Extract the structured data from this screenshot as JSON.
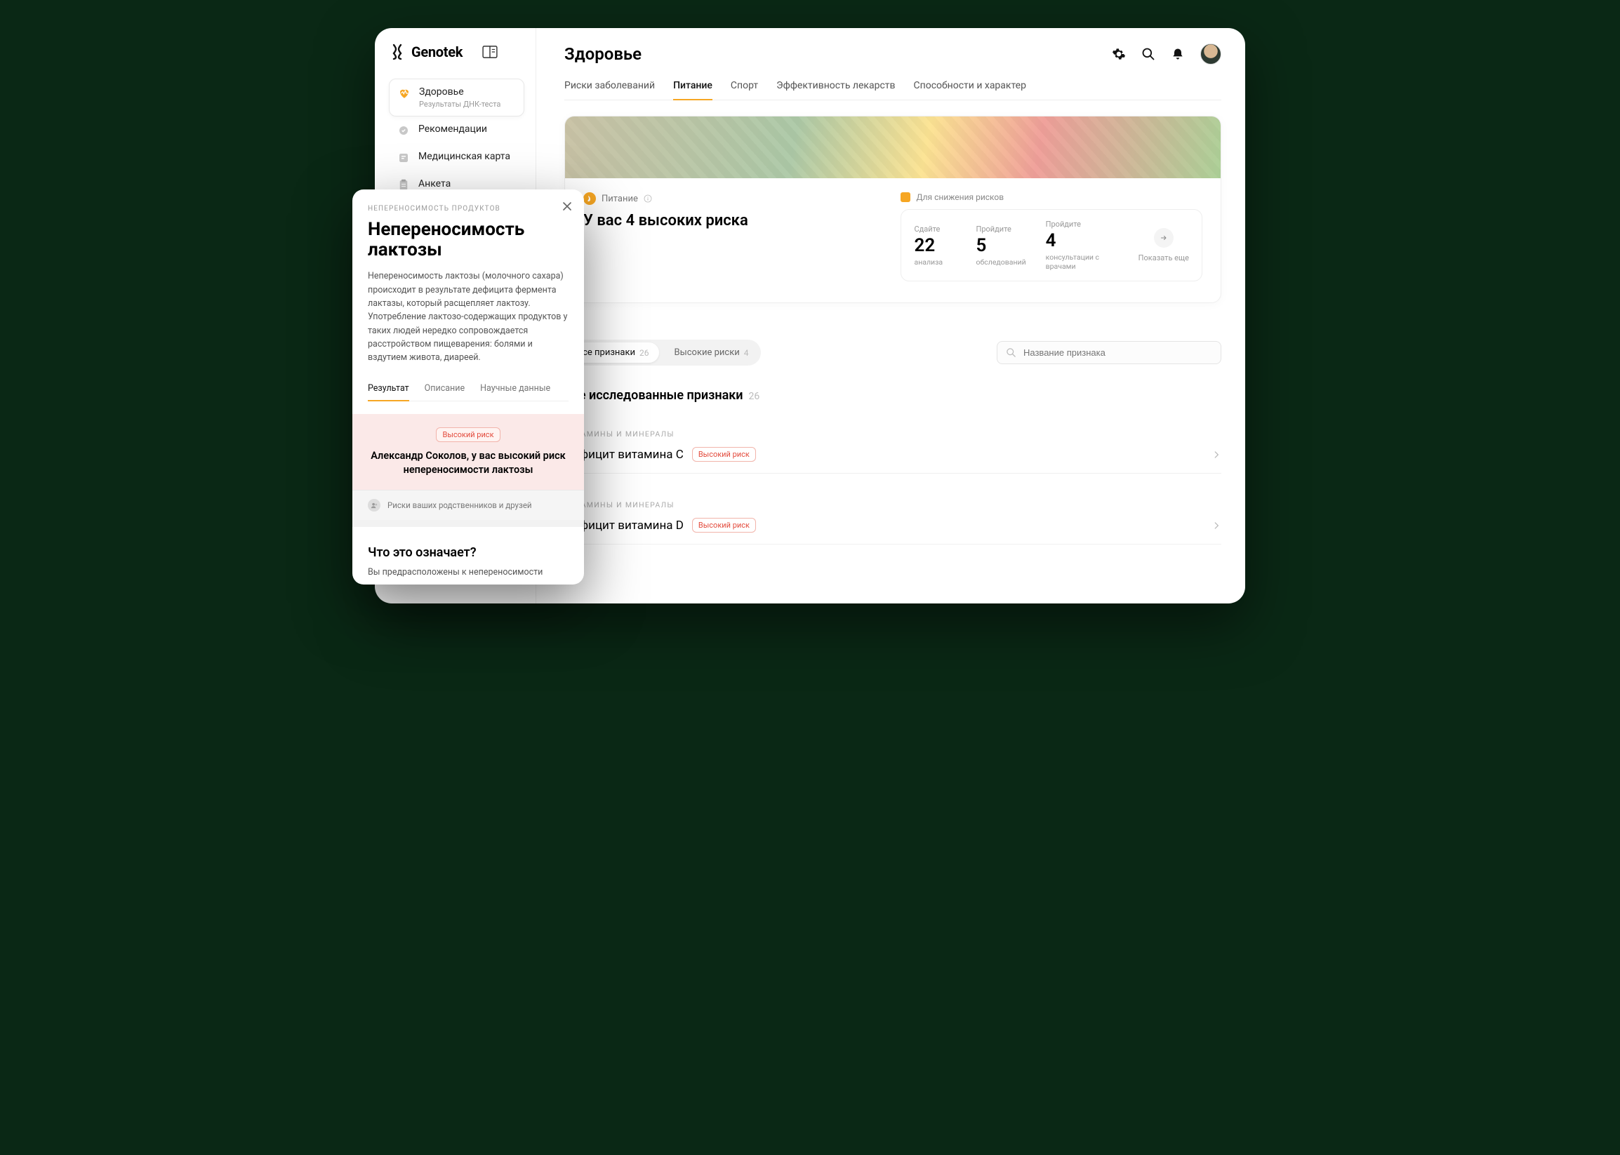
{
  "brand": {
    "name": "Genotek"
  },
  "sidebar": {
    "items": [
      {
        "label": "Здоровье",
        "sub": "Результаты ДНК-теста",
        "icon": "heart-icon",
        "active": true
      },
      {
        "label": "Рекомендации",
        "icon": "badge-icon"
      },
      {
        "label": "Медицинская карта",
        "icon": "card-icon"
      },
      {
        "label": "Анкета",
        "icon": "form-icon"
      }
    ]
  },
  "header": {
    "title": "Здоровье"
  },
  "tabs": [
    {
      "label": "Риски заболеваний"
    },
    {
      "label": "Питание",
      "active": true
    },
    {
      "label": "Спорт"
    },
    {
      "label": "Эффективность лекарств"
    },
    {
      "label": "Способности и характер"
    }
  ],
  "hero": {
    "label": "Питание",
    "headline": "У вас 4 высоких риска",
    "reduce_label": "Для снижения рисков",
    "stats": [
      {
        "cap": "Сдайте",
        "num": "22",
        "sub": "анализа"
      },
      {
        "cap": "Пройдите",
        "num": "5",
        "sub": "обследований"
      },
      {
        "cap": "Пройдите",
        "num": "4",
        "sub": "консультации с врачами"
      }
    ],
    "show_more": "Показать еще"
  },
  "filters": {
    "chips": [
      {
        "label": "Все признаки",
        "count": "26",
        "active": true
      },
      {
        "label": "Высокие риски",
        "count": "4"
      }
    ],
    "search_placeholder": "Название признака"
  },
  "section": {
    "title": "Все исследованные признаки",
    "count": "26"
  },
  "groups": [
    {
      "label": "ВИТАМИНЫ И МИНЕРАЛЫ",
      "name": "Дефицит витамина C",
      "risk": "Высокий риск"
    },
    {
      "label": "ВИТАМИНЫ И МИНЕРАЛЫ",
      "name": "Дефицит витамина D",
      "risk": "Высокий риск"
    }
  ],
  "modal": {
    "eyebrow": "НЕПЕРЕНОСИМОСТЬ ПРОДУКТОВ",
    "title": "Непереносимость лактозы",
    "desc": "Непереносимость лактозы (молочного сахара) происходит в результате дефицита фермента лактазы, который расщепляет лактозу. Употребление лактозо-содержащих продуктов у таких людей нередко сопровождается расстройством пищеварения: болями и вздутием живота, диареей.",
    "tabs": [
      {
        "label": "Результат",
        "active": true
      },
      {
        "label": "Описание"
      },
      {
        "label": "Научные данные"
      }
    ],
    "risk_badge": "Высокий риск",
    "risk_msg": "Александр Соколов, у вас высокий риск непереносимости лактозы",
    "relatives": "Риски ваших родственников и друзей",
    "meaning_title": "Что это означает?",
    "meaning_body": "Вы предрасположены к непереносимости"
  }
}
